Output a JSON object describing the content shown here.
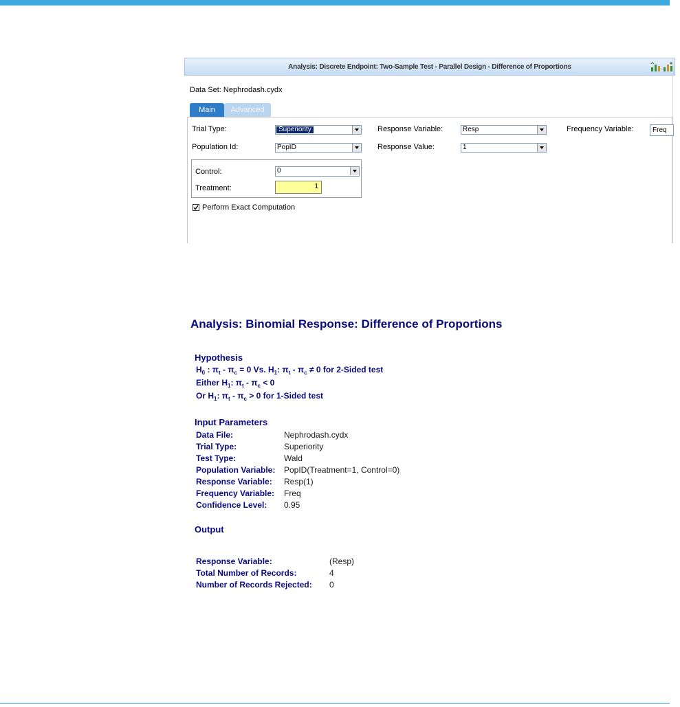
{
  "dialog": {
    "title": "Analysis: Discrete Endpoint: Two-Sample Test - Parallel Design - Difference of Proportions",
    "data_set": "Data Set: Nephrodash.cydx",
    "tabs": [
      "Main",
      "Advanced"
    ],
    "fields": {
      "trial_type_label": "Trial Type:",
      "trial_type_value": "Superiority",
      "response_variable_label": "Response Variable:",
      "response_variable_value": "Resp",
      "frequency_variable_label": "Frequency Variable:",
      "frequency_variable_value": "Freq",
      "population_id_label": "Population Id:",
      "population_id_value": "PopID",
      "response_value_label": "Response Value:",
      "response_value_value": "1",
      "control_label": "Control:",
      "control_value": "0",
      "treatment_label": "Treatment:",
      "treatment_value": "1",
      "exact_label": "Perform Exact Computation",
      "exact_checked": true
    },
    "header_icons": [
      "bar-chart-icon",
      "bar-chart-add-icon"
    ]
  },
  "report": {
    "title": "Analysis: Binomial Response: Difference of Proportions",
    "hypothesis_heading": "Hypothesis",
    "hypothesis_lines": [
      "H0 : πt - πc = 0 Vs. H1: πt - πc ≠ 0 for 2-Sided test",
      "Either H1: πt - πc < 0",
      "Or H1: πt - πc > 0 for 1-Sided test"
    ],
    "input_heading": "Input Parameters",
    "input_params": [
      {
        "key": "Data File:",
        "value": "Nephrodash.cydx"
      },
      {
        "key": "Trial Type:",
        "value": "Superiority"
      },
      {
        "key": "Test Type:",
        "value": "Wald"
      },
      {
        "key": "Population Variable:",
        "value": "PopID(Treatment=1, Control=0)"
      },
      {
        "key": "Response Variable:",
        "value": "Resp(1)"
      },
      {
        "key": "Frequency Variable:",
        "value": "Freq"
      },
      {
        "key": "Confidence Level:",
        "value": "0.95"
      }
    ],
    "output_heading": "Output",
    "output_params": [
      {
        "key": "Response Variable:",
        "value": "(Resp)"
      },
      {
        "key": "Total Number of Records:",
        "value": "4"
      },
      {
        "key": "Number of Records Rejected:",
        "value": "0"
      }
    ]
  }
}
